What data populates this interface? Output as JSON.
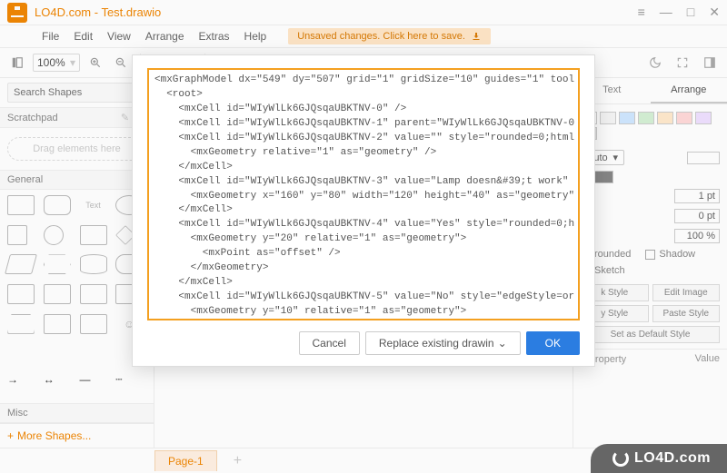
{
  "window": {
    "title": "LO4D.com - Test.drawio",
    "controls": {
      "appmenu": "≡",
      "minimize": "—",
      "maximize": "□",
      "close": "✕"
    }
  },
  "menus": [
    "File",
    "Edit",
    "View",
    "Arrange",
    "Extras",
    "Help"
  ],
  "unsaved_banner": "Unsaved changes. Click here to save.",
  "toolbar": {
    "zoom": "100%"
  },
  "left": {
    "search_placeholder": "Search Shapes",
    "scratchpad_label": "Scratchpad",
    "scratchpad_hint": "Drag elements here",
    "general_label": "General",
    "misc_label": "Misc",
    "more_shapes": "More Shapes..."
  },
  "right": {
    "tab_text": "Text",
    "tab_arrange": "Arrange",
    "swatches": [
      "#ffffff",
      "#f5f5f5",
      "#d0e7ff",
      "#d5f0d5",
      "#ffe9cc",
      "#ffd9d9",
      "#efe0ff",
      "#e0e0e0"
    ],
    "auto_label": "Auto",
    "pt1": "1 pt",
    "pt0": "0 pt",
    "pct100": "100 %",
    "rounded": "rounded",
    "shadow": "Shadow",
    "sketch": "Sketch",
    "edit_style": "k Style",
    "edit_image": "Edit Image",
    "copy_style": "y Style",
    "paste_style": "Paste Style",
    "default_style": "Set as Default Style",
    "property": "Property",
    "value": "Value"
  },
  "footer": {
    "page1": "Page-1"
  },
  "modal": {
    "xml": "<mxGraphModel dx=\"549\" dy=\"507\" grid=\"1\" gridSize=\"10\" guides=\"1\" tool\n  <root>\n    <mxCell id=\"WIyWlLk6GJQsqaUBKTNV-0\" />\n    <mxCell id=\"WIyWlLk6GJQsqaUBKTNV-1\" parent=\"WIyWlLk6GJQsqaUBKTNV-0\n    <mxCell id=\"WIyWlLk6GJQsqaUBKTNV-2\" value=\"\" style=\"rounded=0;html\n      <mxGeometry relative=\"1\" as=\"geometry\" />\n    </mxCell>\n    <mxCell id=\"WIyWlLk6GJQsqaUBKTNV-3\" value=\"Lamp doesn&#39;t work\"\n      <mxGeometry x=\"160\" y=\"80\" width=\"120\" height=\"40\" as=\"geometry\"\n    </mxCell>\n    <mxCell id=\"WIyWlLk6GJQsqaUBKTNV-4\" value=\"Yes\" style=\"rounded=0;h\n      <mxGeometry y=\"20\" relative=\"1\" as=\"geometry\">\n        <mxPoint as=\"offset\" />\n      </mxGeometry>\n    </mxCell>\n    <mxCell id=\"WIyWlLk6GJQsqaUBKTNV-5\" value=\"No\" style=\"edgeStyle=or\n      <mxGeometry y=\"10\" relative=\"1\" as=\"geometry\">\n        <mxPoint as=\"offset\" />\n      </mxGeometry>\n    </mxCell>\n    <mxCell id=\"WIyWlLk6GJQsqaUBKTNV-6\" value=\"Lamp&lt;br&gt;plugged i\n      <mxGeometry x=\"170\" y=\"170\" width=\"100\" height=\"80\" as=\"geometry",
    "cancel": "Cancel",
    "replace": "Replace existing drawin",
    "ok": "OK"
  },
  "watermark": "LO4D.com"
}
